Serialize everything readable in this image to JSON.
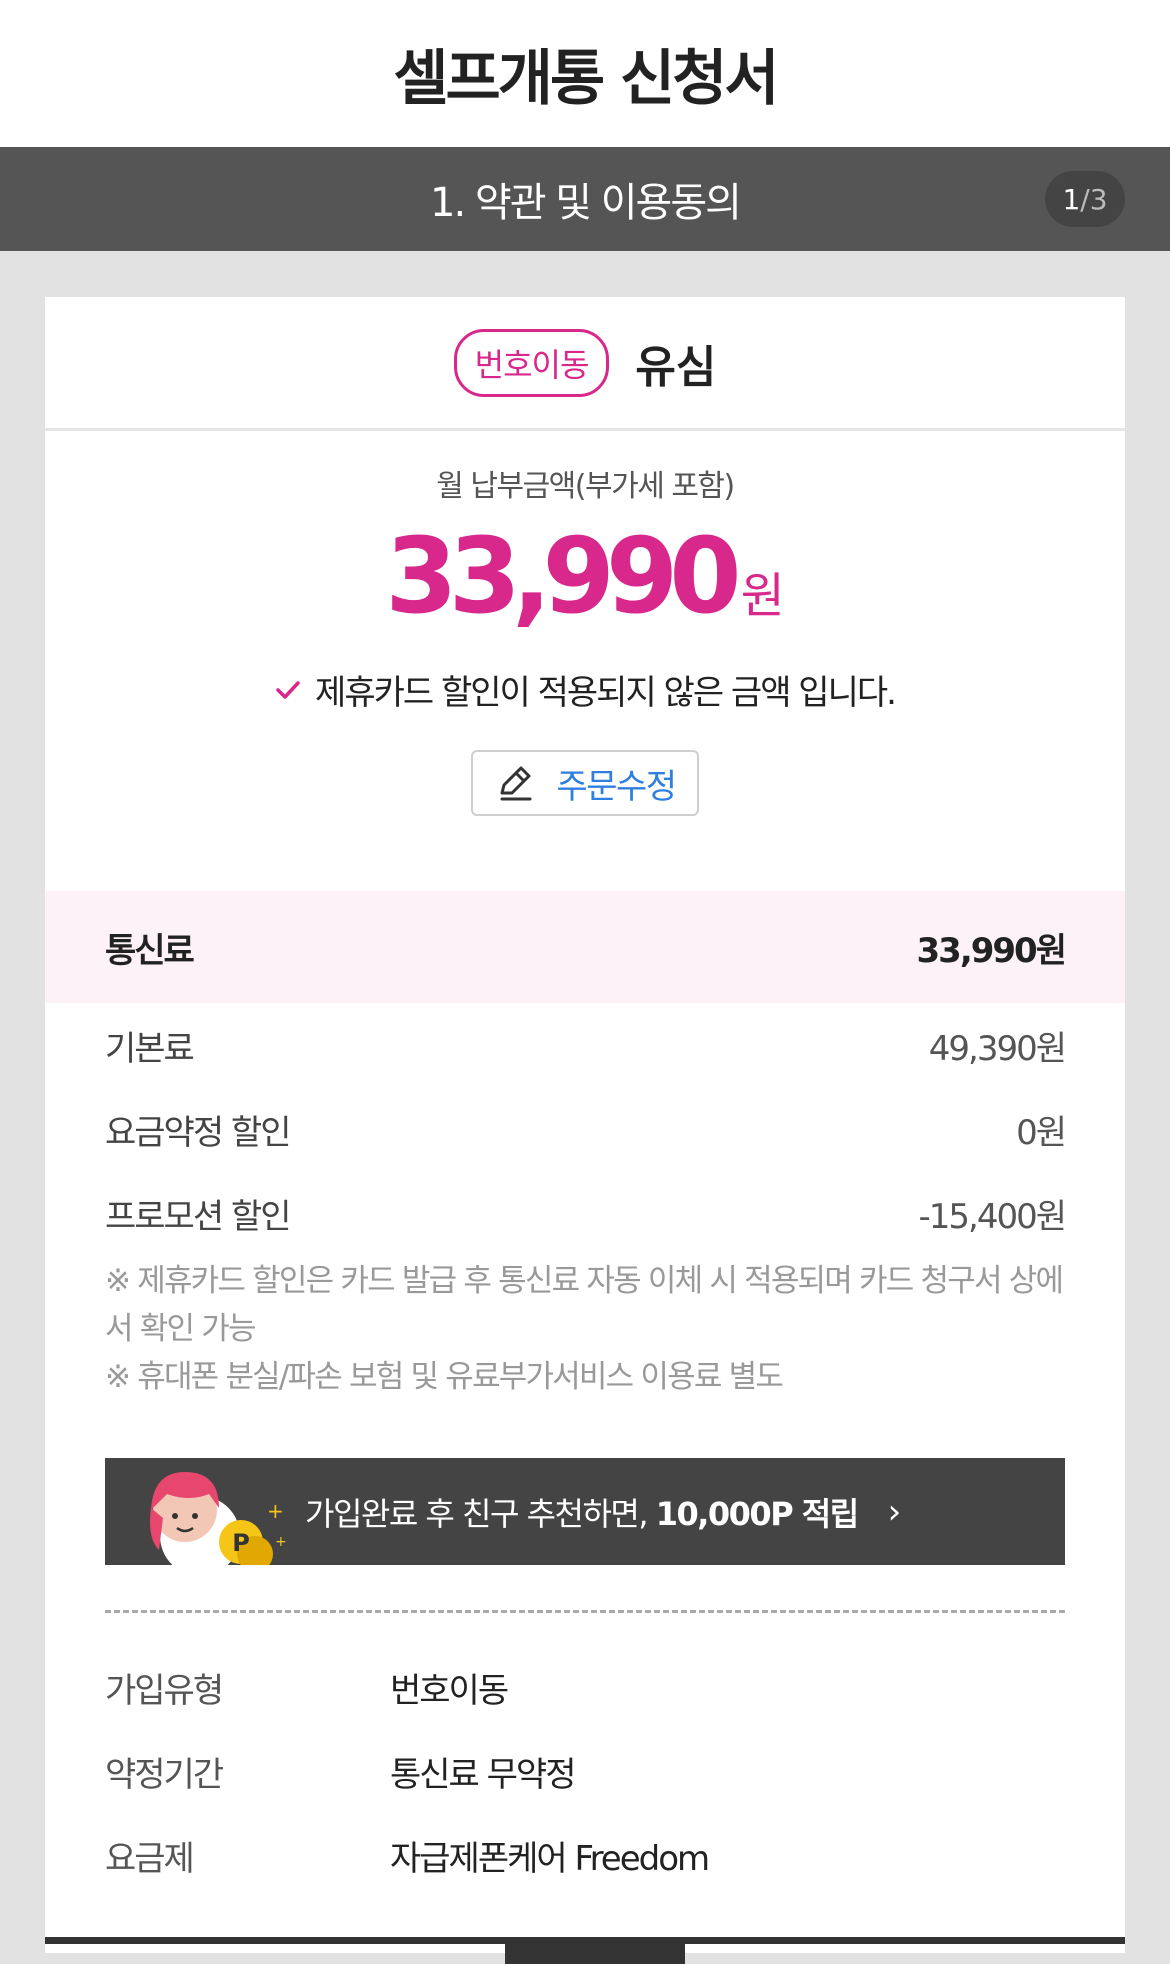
{
  "header": {
    "title": "셀프개통 신청서"
  },
  "step": {
    "title": "1. 약관 및 이용동의",
    "current": "1",
    "total": "/3"
  },
  "card": {
    "badge": "번호이동",
    "product": "유심",
    "monthly_label": "월 납부금액(부가세 포함)",
    "price": "33,990",
    "price_unit": "원",
    "notice": "제휴카드 할인이 적용되지 않은 금액 입니다.",
    "edit_button": "주문수정"
  },
  "fee": {
    "head_label": "통신료",
    "head_value": "33,990원",
    "rows": [
      {
        "label": "기본료",
        "value": "49,390원"
      },
      {
        "label": "요금약정 할인",
        "value": "0원"
      },
      {
        "label": "프로모션 할인",
        "value": "-15,400원"
      }
    ],
    "notes": [
      "※ 제휴카드 할인은 카드 발급 후 통신료 자동 이체 시 적용되며 카드 청구서 상에서 확인 가능",
      "※ 휴대폰 분실/파손 보험 및 유료부가서비스 이용료 별도"
    ]
  },
  "banner": {
    "text": "가입완료 후 친구 추천하면, ",
    "bold": "10,000P 적립",
    "arrow": "›"
  },
  "info": [
    {
      "key": "가입유형",
      "value": "번호이동"
    },
    {
      "key": "약정기간",
      "value": "통신료 무약정"
    },
    {
      "key": "요금제",
      "value": "자급제폰케어 Freedom"
    }
  ],
  "colors": {
    "accent": "#d9288c",
    "link": "#2f7fe0",
    "bar": "#555555",
    "banner": "#444444"
  },
  "icons": {
    "notice": "check-icon",
    "edit": "pencil-icon",
    "banner": "point-coin-icon"
  }
}
